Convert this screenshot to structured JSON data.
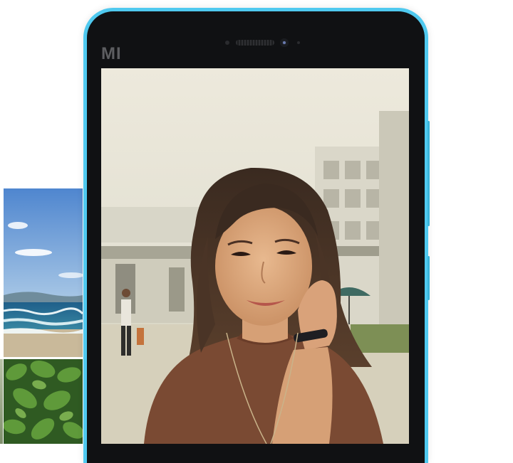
{
  "device": {
    "brand_logo": "MI",
    "frame_color": "#4fc9ef",
    "bezel_color": "#101113"
  },
  "screen": {
    "wallpaper": "selfie-portrait-photo"
  },
  "thumbnails": [
    {
      "name": "beach-photo"
    },
    {
      "name": "leaves-photo"
    }
  ]
}
